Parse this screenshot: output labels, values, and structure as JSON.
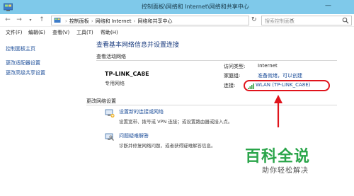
{
  "window": {
    "title": "控制面板\\网络和 Internet\\网络和共享中心",
    "minimize_glyph": "—"
  },
  "address": {
    "crumbs": [
      "控制面板",
      "网络和 Internet",
      "网络和共享中心"
    ],
    "search_placeholder": "搜索控制面板"
  },
  "menu": {
    "items": [
      "文件(F)",
      "编辑(E)",
      "查看(V)",
      "工具(T)",
      "帮助(H)"
    ]
  },
  "sidebar": {
    "items": [
      "控制面板主页",
      "更改适配器设置",
      "更改高级共享设置"
    ]
  },
  "main": {
    "heading": "查看基本网络信息并设置连接",
    "active_networks_label": "查看活动网络",
    "network_name": "TP-LINK_CA8E",
    "network_type": "专用网络",
    "access_type_label": "访问类型:",
    "access_type_value": "Internet",
    "homegroup_label": "家庭组:",
    "homegroup_value": "准备就绪，可以创建",
    "connection_label": "连接:",
    "connection_value": "WLAN (TP-LINK_CA8E)",
    "change_settings_label": "更改网络设置",
    "tasks": [
      {
        "icon": "network-setup-icon",
        "link": "设置新的连接或网络",
        "desc": "设置宽带、拨号或 VPN 连接；或设置路由器或接入点。"
      },
      {
        "icon": "troubleshoot-icon",
        "link": "问题疑难解答",
        "desc": "诊断并修复网络问题，或者获得疑难解答信息。"
      }
    ]
  },
  "watermark": {
    "logo": "百科全说",
    "slogan": "助你轻松解决"
  },
  "colors": {
    "titlebar": "#7fc9ea",
    "link": "#1e4f9a",
    "highlight": "#e0141c",
    "watermark": "#2aa54a"
  }
}
